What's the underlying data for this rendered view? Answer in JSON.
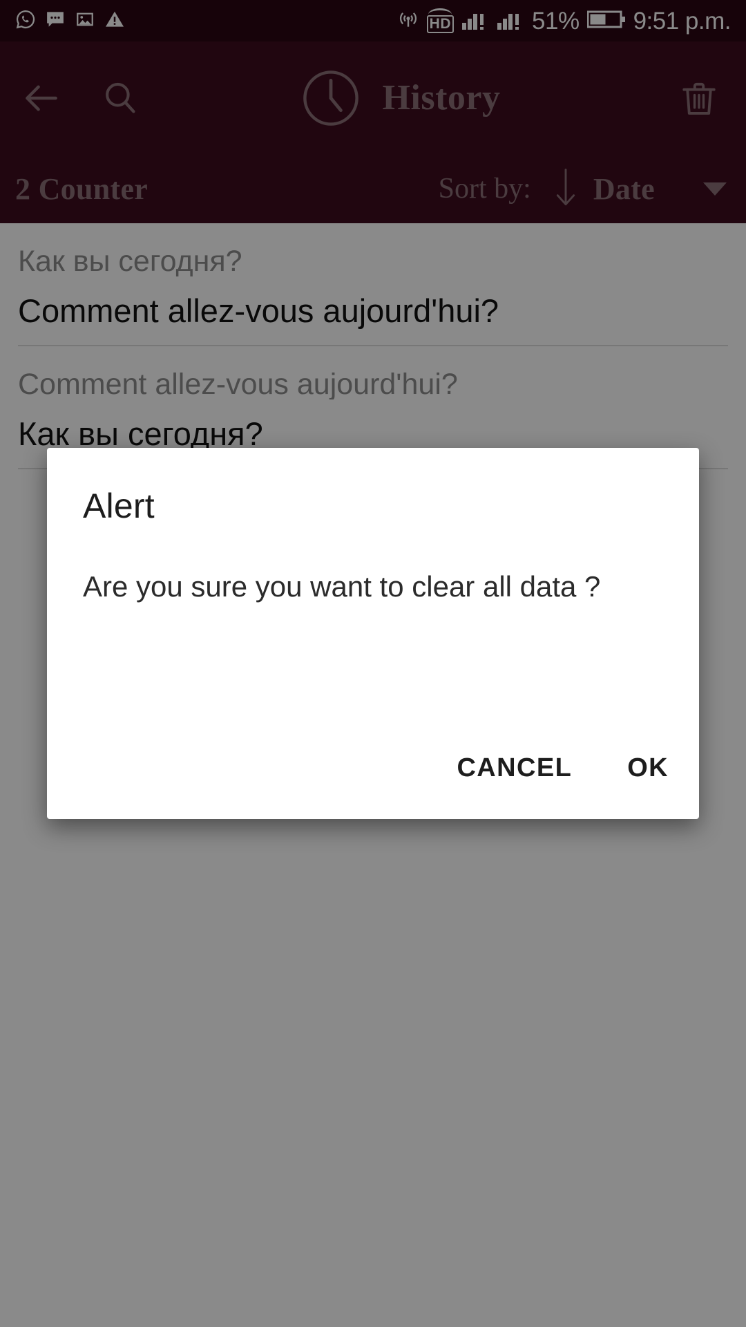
{
  "status_bar": {
    "time": "9:51 p.m.",
    "battery_percent": "51%",
    "network_label": "HD",
    "left_icons": [
      "whatsapp-icon",
      "sms-icon",
      "screenshot-icon",
      "warning-icon"
    ],
    "right_icons": [
      "hotspot-icon",
      "hd-voice-icon",
      "signal-sim1-icon",
      "signal-sim2-icon",
      "battery-icon"
    ],
    "background_color": "#2b0713"
  },
  "app_bar": {
    "title": "History",
    "back_icon": "arrow-left-icon",
    "search_icon": "search-icon",
    "clock_icon": "clock-icon",
    "delete_icon": "trash-icon",
    "background_color": "#3d0c1f",
    "foreground_color": "#8b7077"
  },
  "sort_bar": {
    "counter_label": "2 Counter",
    "sort_by_label": "Sort by:",
    "sort_direction_icon": "arrow-down-icon",
    "sort_value": "Date",
    "dropdown_icon": "caret-down-icon"
  },
  "history": {
    "items": [
      {
        "source_text": "Как вы сегодня?",
        "translated_text": "Comment allez-vous aujourd'hui?"
      },
      {
        "source_text": "Comment allez-vous aujourd'hui?",
        "translated_text": "Как вы сегодня?"
      }
    ]
  },
  "dialog": {
    "title": "Alert",
    "message": "Are you sure you want to clear all data ?",
    "cancel_label": "CANCEL",
    "ok_label": "OK"
  }
}
